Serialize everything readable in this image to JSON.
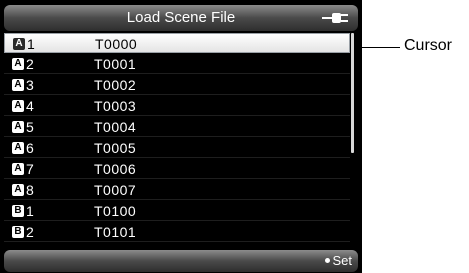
{
  "window": {
    "title": "Load Scene File"
  },
  "icons": {
    "power": "plug-icon",
    "set": "dot-icon"
  },
  "files": [
    {
      "group": "A",
      "number": "1",
      "name": "T0000",
      "selected": true
    },
    {
      "group": "A",
      "number": "2",
      "name": "T0001"
    },
    {
      "group": "A",
      "number": "3",
      "name": "T0002"
    },
    {
      "group": "A",
      "number": "4",
      "name": "T0003"
    },
    {
      "group": "A",
      "number": "5",
      "name": "T0004"
    },
    {
      "group": "A",
      "number": "6",
      "name": "T0005"
    },
    {
      "group": "A",
      "number": "7",
      "name": "T0006"
    },
    {
      "group": "A",
      "number": "8",
      "name": "T0007"
    },
    {
      "group": "B",
      "number": "1",
      "name": "T0100"
    },
    {
      "group": "B",
      "number": "2",
      "name": "T0101"
    }
  ],
  "footer": {
    "set_label": "Set"
  },
  "annotation": {
    "cursor_label": "Cursor"
  }
}
